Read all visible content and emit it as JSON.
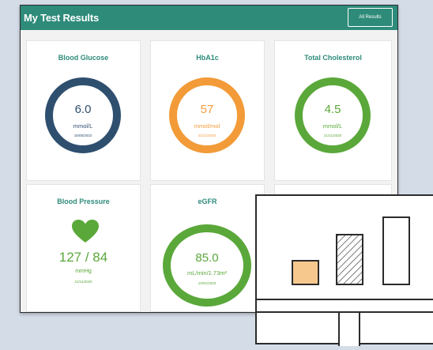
{
  "header": {
    "title": "My Test Results",
    "button_label": "All Results"
  },
  "cards": [
    {
      "title": "Blood Glucose",
      "value": "6.0",
      "unit": "mmol/L",
      "date": "16/05/2022",
      "color": "#2f4f6f"
    },
    {
      "title": "HbA1c",
      "value": "57",
      "unit": "mmol/mol",
      "date": "21/11/2020",
      "color": "#f29b38"
    },
    {
      "title": "Total Cholesterol",
      "value": "4.5",
      "unit": "mmol/L",
      "date": "21/11/2020",
      "color": "#5aa83a"
    },
    {
      "title": "Blood Pressure",
      "value": "127 / 84",
      "unit": "mmHg",
      "date": "21/11/2020",
      "color": "#5aa83a"
    },
    {
      "title": "eGFR",
      "value": "85.0",
      "unit": "mL/min/1.73m²",
      "date": "10/01/2020",
      "color": "#5aa83a"
    }
  ],
  "colors": {
    "header_bg": "#2e8b7a",
    "accent_text": "#2e8b7a",
    "overlay_bar": "#f6c88e"
  }
}
